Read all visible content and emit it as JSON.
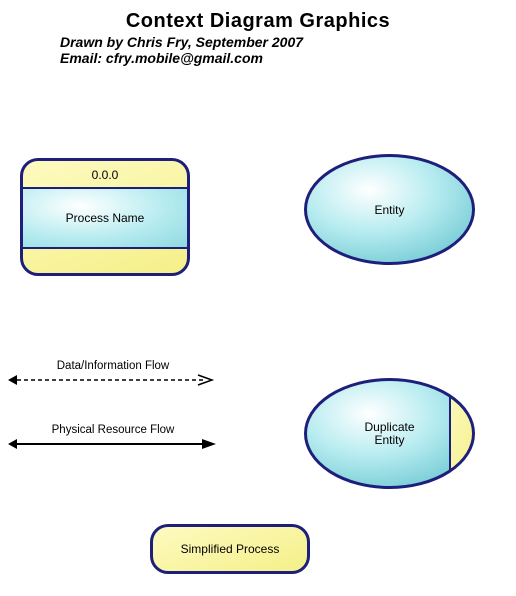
{
  "title": "Context Diagram Graphics",
  "subtitle_line1": "Drawn by Chris Fry, September 2007",
  "subtitle_line2": "Email: cfry.mobile@gmail.com",
  "process": {
    "number": "0.0.0",
    "name": "Process Name"
  },
  "entity": {
    "label": "Entity"
  },
  "duplicate_entity": {
    "label_line1": "Duplicate",
    "label_line2": "Entity"
  },
  "flows": {
    "data_label": "Data/Information Flow",
    "physical_label": "Physical Resource Flow"
  },
  "simplified_process": {
    "label": "Simplified Process"
  },
  "colors": {
    "stroke": "#1d1f7a",
    "yellow_light": "#fdfac0",
    "yellow_dark": "#f5f089",
    "cyan_light": "#ffffff",
    "cyan_mid": "#b7ecf0",
    "cyan_dark": "#8fd9e0"
  }
}
